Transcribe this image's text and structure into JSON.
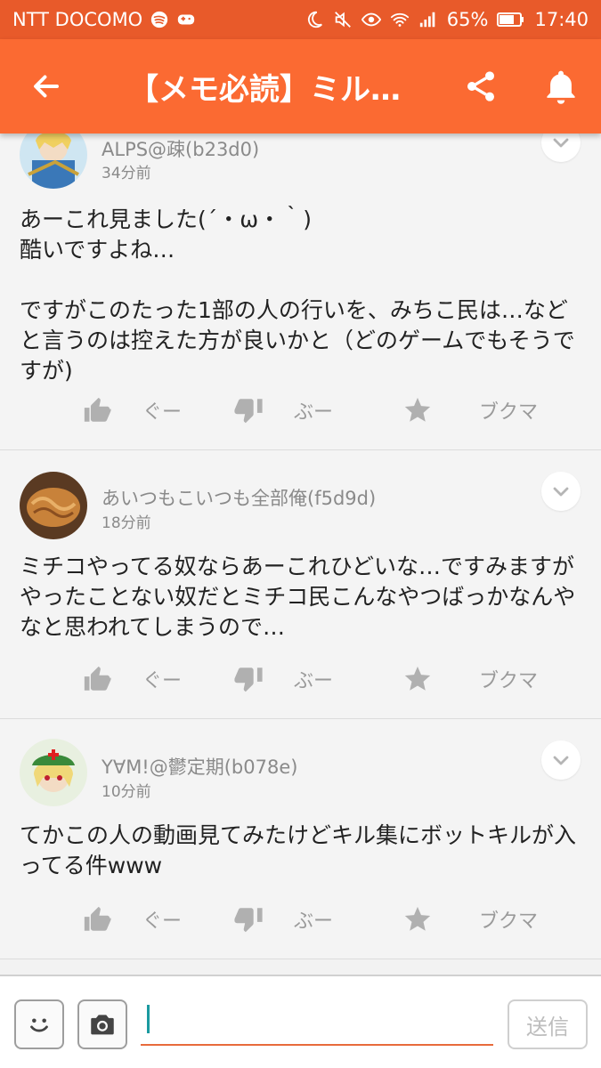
{
  "status_bar": {
    "carrier": "NTT DOCOMO",
    "battery": "65%",
    "time": "17:40",
    "icons": [
      "spotify-icon",
      "game-icon",
      "moon-icon",
      "mute-icon",
      "eye-icon",
      "wifi-icon",
      "signal-icon",
      "battery-icon"
    ]
  },
  "app_bar": {
    "title": "【メモ必読】ミル…",
    "icons": [
      "back-arrow-icon",
      "share-icon",
      "bell-icon"
    ]
  },
  "comments": [
    {
      "user": "ALPS@疎(b23d0)",
      "time": "34分前",
      "body": "あーこれ見ました(´・ω・｀)\n酷いですよね…\n\nですがこのたった1部の人の行いを、みちこ民は…などと言うのは控えた方が良いかと（どのゲームでもそうですが)"
    },
    {
      "user": "あいつもこいつも全部俺(f5d9d)",
      "time": "18分前",
      "body": "ミチコやってる奴ならあーこれひどいな…ですみますがやったことない奴だとミチコ民こんなやつばっかなんやなと思われてしまうので…"
    },
    {
      "user": "Y∀M!@鬱定期(b078e)",
      "time": "10分前",
      "body": "てかこの人の動画見てみたけどキル集にボットキルが入ってる件www"
    }
  ],
  "actions": {
    "good": "ぐー",
    "bad": "ぶー",
    "bookmark": "ブクマ"
  },
  "composer": {
    "placeholder": "",
    "send": "送信"
  },
  "colors": {
    "status_bar": "#e85a2a",
    "app_bar": "#fb6a32",
    "input_underline": "#e86b3c",
    "caret": "#1b9aa0"
  }
}
